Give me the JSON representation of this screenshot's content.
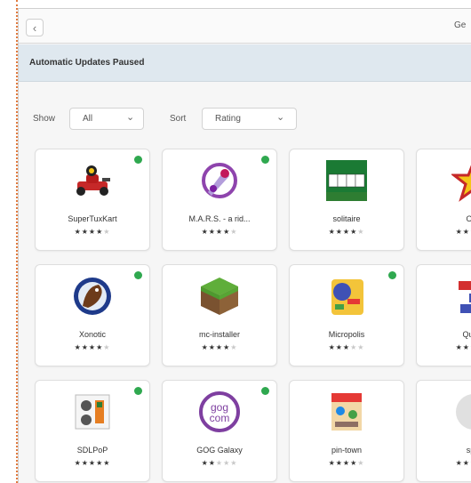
{
  "header": {
    "back_glyph": "‹",
    "title": "Ge"
  },
  "banner": {
    "text": "Automatic Updates Paused"
  },
  "filters": {
    "show_label": "Show",
    "show_value": "All",
    "sort_label": "Sort",
    "sort_value": "Rating",
    "chevron": "⌄"
  },
  "apps": [
    {
      "name": "SuperTuxKart",
      "rating": 4,
      "installed": true,
      "icon": "race-kart-icon"
    },
    {
      "name": "M.A.R.S. - a rid...",
      "rating": 4,
      "installed": true,
      "icon": "mars-ship-icon"
    },
    {
      "name": "solitaire",
      "rating": 4,
      "installed": false,
      "icon": "cards-icon"
    },
    {
      "name": "Ope",
      "rating": 2,
      "installed": false,
      "icon": "star-icon"
    },
    {
      "name": "Xonotic",
      "rating": 4,
      "installed": true,
      "icon": "xonotic-icon"
    },
    {
      "name": "mc-installer",
      "rating": 4,
      "installed": false,
      "icon": "grass-block-icon"
    },
    {
      "name": "Micropolis",
      "rating": 3,
      "installed": true,
      "icon": "map-icon"
    },
    {
      "name": "Quadr",
      "rating": 2,
      "installed": false,
      "icon": "blocks-icon"
    },
    {
      "name": "SDLPoP",
      "rating": 5,
      "installed": true,
      "icon": "prince-icon"
    },
    {
      "name": "GOG Galaxy",
      "rating": 2,
      "installed": true,
      "icon": "gog-icon"
    },
    {
      "name": "pin-town",
      "rating": 4,
      "installed": false,
      "icon": "pinball-icon"
    },
    {
      "name": "spel",
      "rating": 2,
      "installed": false,
      "icon": "placeholder-icon"
    }
  ]
}
